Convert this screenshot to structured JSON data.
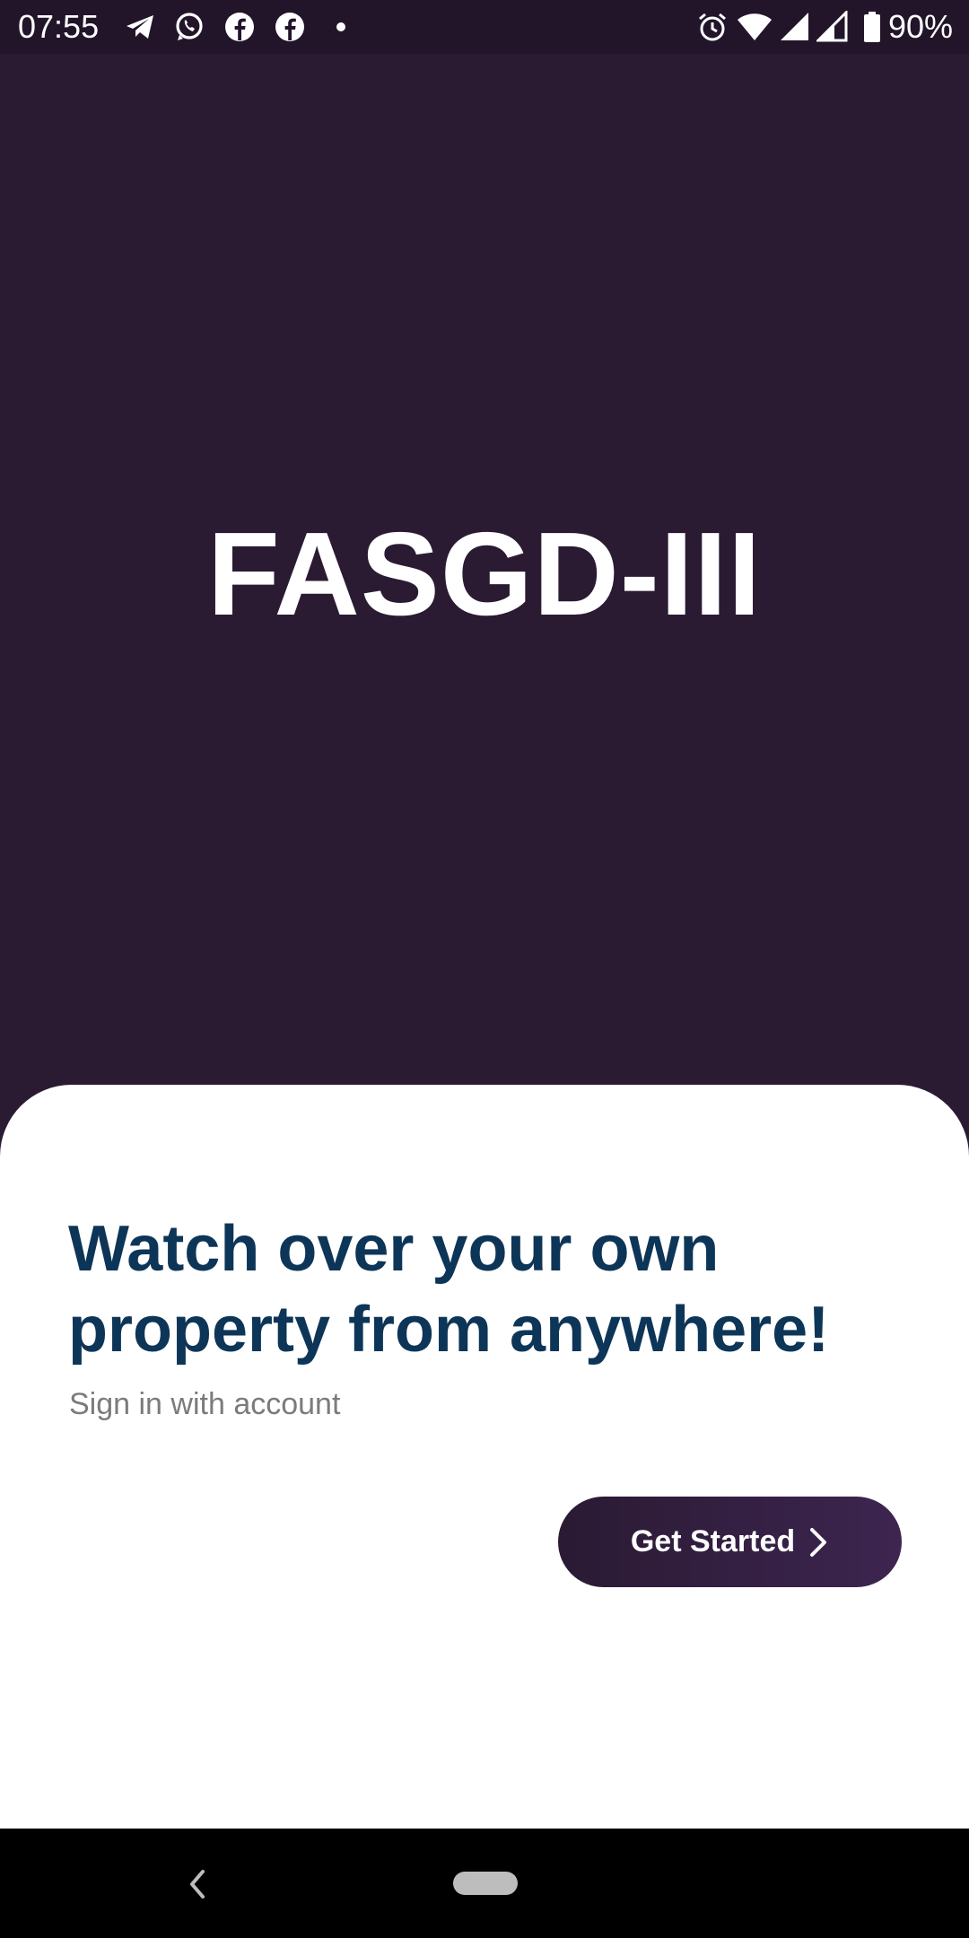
{
  "status_bar": {
    "time": "07:55",
    "battery_percent": "90%",
    "notification_icons": [
      "telegram-icon",
      "whatsapp-icon",
      "facebook-icon",
      "facebook-icon",
      "dot-icon"
    ],
    "system_icons": [
      "alarm-icon",
      "wifi-icon",
      "signal-icon",
      "signal-icon",
      "battery-icon"
    ]
  },
  "hero": {
    "app_title": "FASGD-III"
  },
  "sheet": {
    "headline": "Watch over your own property from anywhere!",
    "subtitle": "Sign in with account",
    "cta_label": "Get Started"
  },
  "nav_bar": {
    "buttons": [
      "back-icon",
      "home-pill"
    ]
  },
  "colors": {
    "background": "#2a1b33",
    "status_bar": "#22152a",
    "headline": "#0d3557",
    "subtitle": "#7b7b7b",
    "button": "#2a1a33",
    "sheet": "#ffffff"
  }
}
